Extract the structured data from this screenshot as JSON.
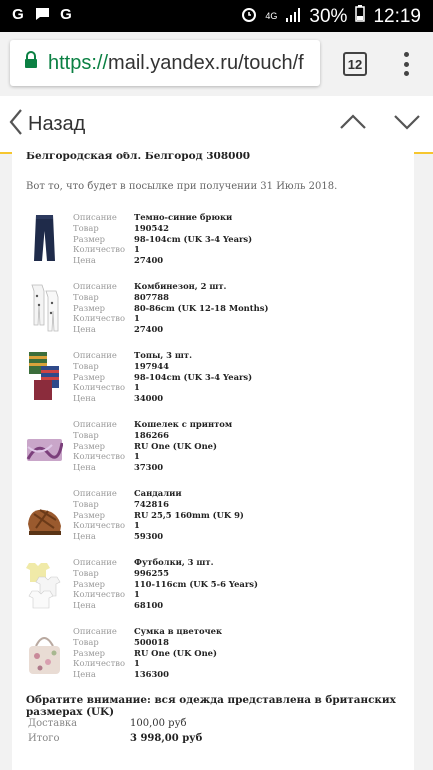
{
  "status_bar": {
    "network_label": "4G",
    "battery_percent": "30%",
    "time": "12:19"
  },
  "browser": {
    "url_protocol": "https://",
    "url_rest": "mail.yandex.ru/touch/f",
    "tab_count": "12"
  },
  "nav": {
    "back_label": "Назад"
  },
  "email": {
    "address_line": "Белгородская обл. Белгород 308000",
    "intro": "Вот то, что будет в посылке при получении 31 Июль 2018.",
    "field_labels": {
      "description": "Описание",
      "product": "Товар",
      "size": "Размер",
      "quantity": "Количество",
      "price": "Цена"
    },
    "items": [
      {
        "description": "Темно-синие брюки",
        "product": "190542",
        "size": "98-104cm (UK 3-4 Years)",
        "quantity": "1",
        "price": "27400",
        "icon": "navy-trousers-icon"
      },
      {
        "description": "Комбинезон, 2 шт.",
        "product": "807788",
        "size": "80-86cm (UK 12-18 Months)",
        "quantity": "1",
        "price": "27400",
        "icon": "baby-bodysuit-icon"
      },
      {
        "description": "Топы, 3 шт.",
        "product": "197944",
        "size": "98-104cm (UK 3-4 Years)",
        "quantity": "1",
        "price": "34000",
        "icon": "striped-tops-icon"
      },
      {
        "description": "Кошелек с принтом",
        "product": "186266",
        "size": "RU One (UK One)",
        "quantity": "1",
        "price": "37300",
        "icon": "printed-wallet-icon"
      },
      {
        "description": "Сандалии",
        "product": "742816",
        "size": "RU 25,5 160mm (UK 9)",
        "quantity": "1",
        "price": "59300",
        "icon": "sandal-icon"
      },
      {
        "description": "Футболки, 3 шт.",
        "product": "996255",
        "size": "110-116cm (UK 5-6 Years)",
        "quantity": "1",
        "price": "68100",
        "icon": "tshirts-icon"
      },
      {
        "description": "Сумка в цветочек",
        "product": "500018",
        "size": "RU One (UK One)",
        "quantity": "1",
        "price": "136300",
        "icon": "floral-bag-icon"
      }
    ],
    "note": "Обратите внимание: вся одежда представлена в британских размерах (UK)",
    "summary": {
      "delivery_label": "Доставка",
      "delivery_value": "100,00 руб",
      "total_label": "Итого",
      "total_value": "3 998,00 руб"
    }
  }
}
